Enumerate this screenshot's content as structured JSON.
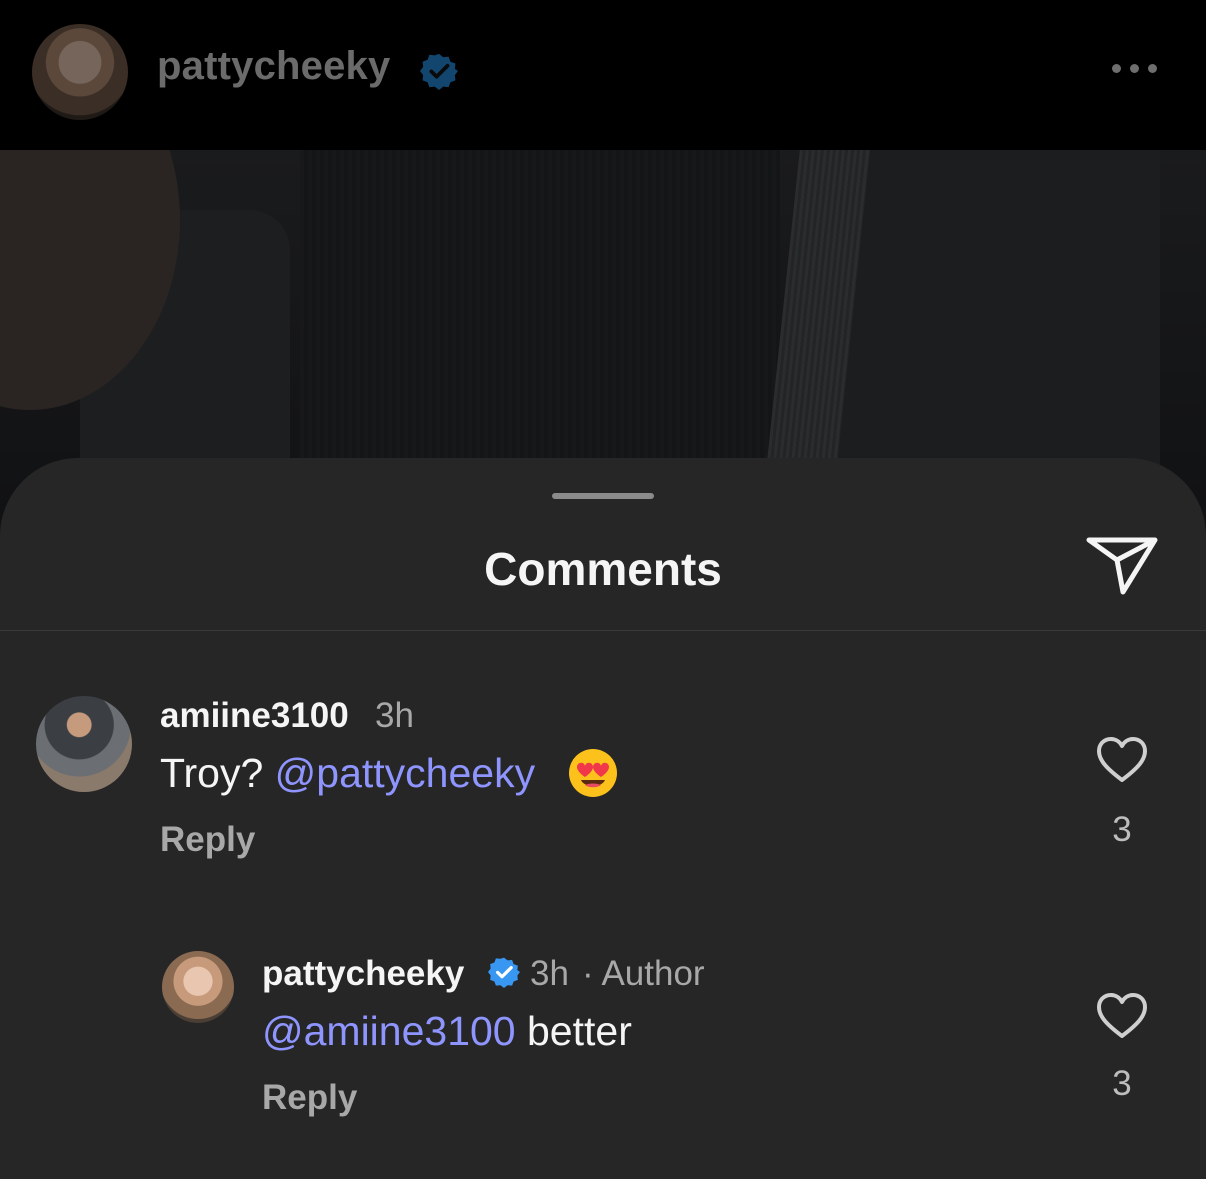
{
  "header": {
    "username": "pattycheeky",
    "verified": true,
    "more_icon": "more-horizontal-icon"
  },
  "sheet": {
    "title": "Comments",
    "share_icon": "paper-plane-icon"
  },
  "comments": [
    {
      "username": "amiine3100",
      "time": "3h",
      "text_prefix": "Troy? ",
      "mention": "@pattycheeky",
      "emoji": "smiling-face-with-heart-eyes",
      "reply_label": "Reply",
      "likes": "3"
    },
    {
      "username": "pattycheeky",
      "verified": true,
      "time": "3h",
      "author_tag": "· Author",
      "mention": "@amiine3100",
      "text_suffix": " better",
      "reply_label": "Reply",
      "likes": "3"
    }
  ],
  "colors": {
    "sheet_bg": "#262626",
    "mention": "#8f95ff",
    "verified": "#3897f0",
    "secondary_text": "#a8a8a8"
  }
}
